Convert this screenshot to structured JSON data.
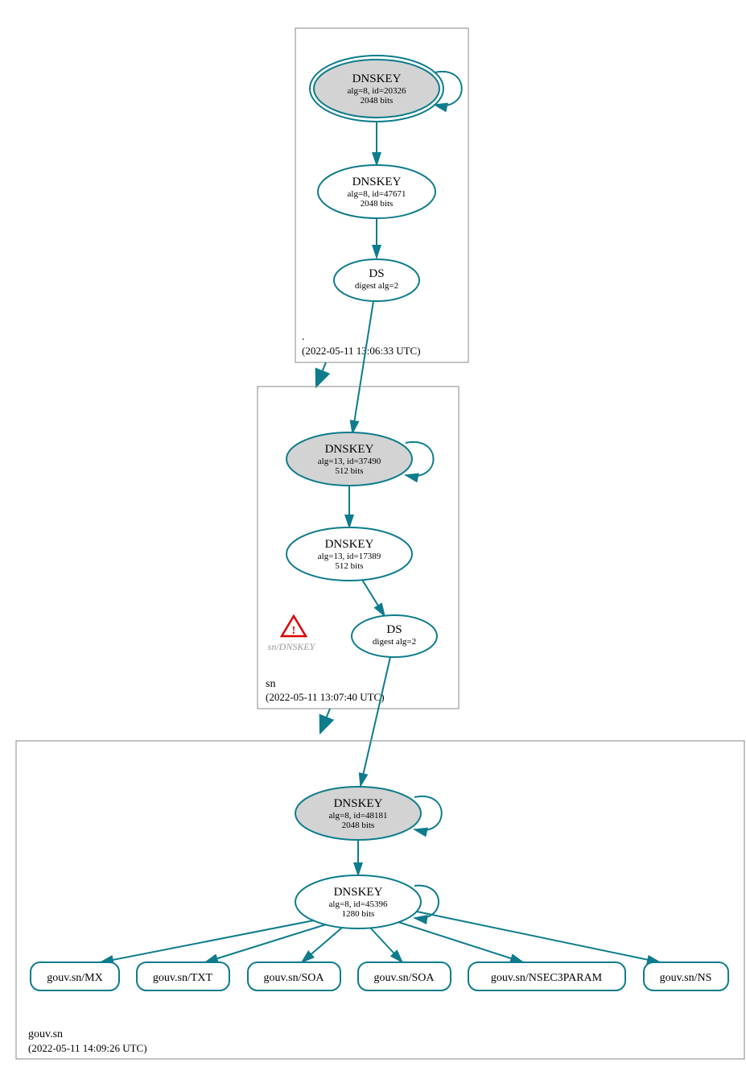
{
  "zones": [
    {
      "name": ".",
      "timestamp": "(2022-05-11 13:06:33 UTC)"
    },
    {
      "name": "sn",
      "timestamp": "(2022-05-11 13:07:40 UTC)"
    },
    {
      "name": "gouv.sn",
      "timestamp": "(2022-05-11 14:09:26 UTC)"
    }
  ],
  "nodes": {
    "root_ksk": {
      "title": "DNSKEY",
      "line1": "alg=8, id=20326",
      "line2": "2048 bits"
    },
    "root_zsk": {
      "title": "DNSKEY",
      "line1": "alg=8, id=47671",
      "line2": "2048 bits"
    },
    "root_ds": {
      "title": "DS",
      "line1": "digest alg=2"
    },
    "sn_ksk": {
      "title": "DNSKEY",
      "line1": "alg=13, id=37490",
      "line2": "512 bits"
    },
    "sn_zsk": {
      "title": "DNSKEY",
      "line1": "alg=13, id=17389",
      "line2": "512 bits"
    },
    "sn_ds": {
      "title": "DS",
      "line1": "digest alg=2"
    },
    "gouv_ksk": {
      "title": "DNSKEY",
      "line1": "alg=8, id=48181",
      "line2": "2048 bits"
    },
    "gouv_zsk": {
      "title": "DNSKEY",
      "line1": "alg=8, id=45396",
      "line2": "1280 bits"
    }
  },
  "warn_label": "sn/DNSKEY",
  "rrsets": [
    "gouv.sn/MX",
    "gouv.sn/TXT",
    "gouv.sn/SOA",
    "gouv.sn/SOA",
    "gouv.sn/NSEC3PARAM",
    "gouv.sn/NS"
  ]
}
